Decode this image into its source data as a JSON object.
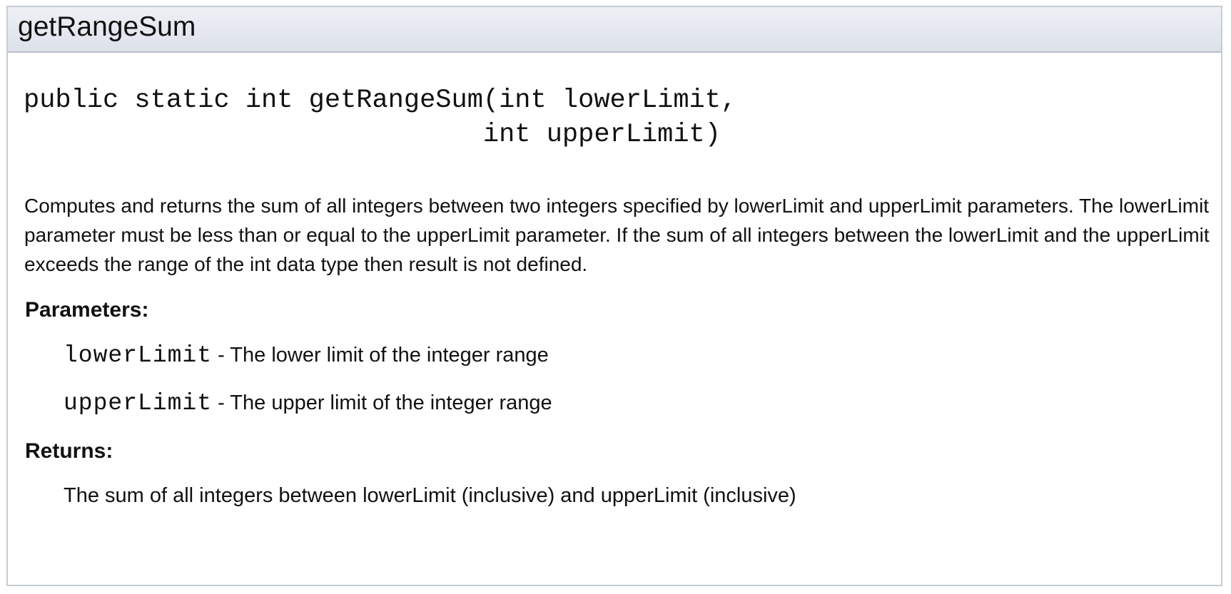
{
  "method": {
    "name": "getRangeSum",
    "signature_line1": "public static int getRangeSum(int lowerLimit,",
    "signature_line2": "                             int upperLimit)",
    "description": "Computes and returns the sum of all integers between two integers specified by lowerLimit and upperLimit parameters. The lowerLimit parameter must be less than or equal to the upperLimit parameter. If the sum of all integers between the lowerLimit and the upperLimit exceeds the range of the int data type then result is not defined."
  },
  "parameters": {
    "label": "Parameters:",
    "items": [
      {
        "name": "lowerLimit",
        "description": " - The lower limit of the integer range"
      },
      {
        "name": "upperLimit",
        "description": " - The upper limit of the integer range"
      }
    ]
  },
  "returns": {
    "label": "Returns:",
    "text": "The sum of all integers between lowerLimit (inclusive) and upperLimit (inclusive)"
  }
}
